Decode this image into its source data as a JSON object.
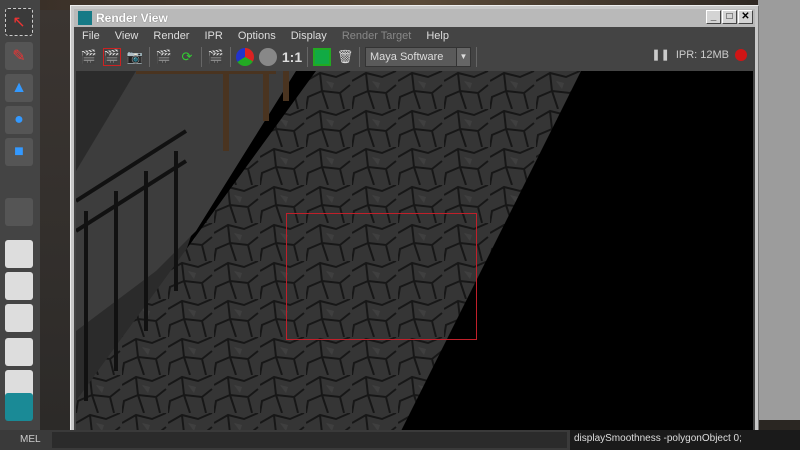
{
  "window": {
    "title": "Render View",
    "minimize": "_",
    "maximize": "□",
    "close": "✕"
  },
  "menu": [
    "File",
    "View",
    "Render",
    "IPR",
    "Options",
    "Display",
    "Render Target",
    "Help"
  ],
  "toolbar": {
    "renderer": "Maya Software",
    "ratio": "1:1",
    "ipr_memory": "IPR: 12MB",
    "pause": "❚❚"
  },
  "command_line": {
    "label": "MEL",
    "output": "displaySmoothness -polygonObject 0;"
  },
  "colors": {
    "selection": "#c0202a",
    "record": "#d01515"
  }
}
